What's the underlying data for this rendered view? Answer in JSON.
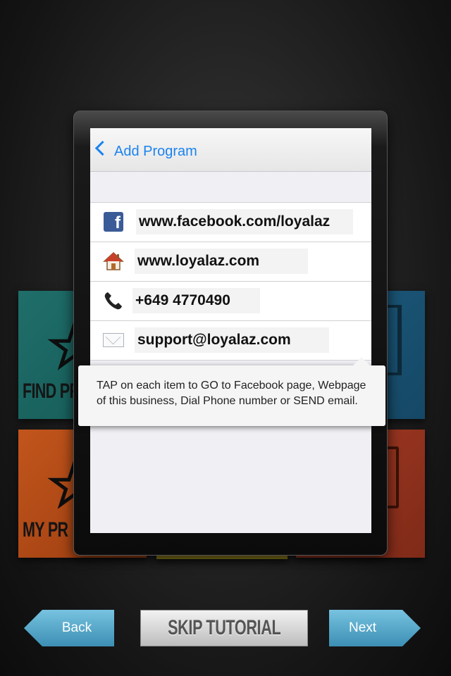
{
  "colors": {
    "accent_blue": "#1a83ee",
    "button_blue": "#5aaed0",
    "facebook_blue": "#3b5b98",
    "teal_tile": "#1f6e6a",
    "orange_tile": "#c2551c",
    "blue_tile": "#1c5a7c",
    "red_tile": "#a33a24"
  },
  "background_tiles": {
    "find": {
      "label": "FIND PR",
      "icon": "star-icon"
    },
    "my": {
      "label": "MY PR",
      "icon": "star-icon"
    },
    "right_top": {
      "icon": "qr-code-icon"
    },
    "right_bottom": {
      "icon": "phone-outline-icon"
    }
  },
  "screen": {
    "nav": {
      "back_label": "Add Program",
      "back_icon": "chevron-left-icon"
    },
    "contacts": [
      {
        "icon": "facebook-icon",
        "value": "www.facebook.com/loyalaz"
      },
      {
        "icon": "home-icon",
        "value": "www.loyalaz.com"
      },
      {
        "icon": "phone-icon",
        "value": "+649 4770490"
      },
      {
        "icon": "mail-icon",
        "value": "support@loyalaz.com"
      }
    ]
  },
  "tooltip": {
    "text": "TAP on each item to GO to Facebook page, Webpage of this business, Dial Phone number or SEND email."
  },
  "footer": {
    "back_label": "Back",
    "skip_label": "SKIP TUTORIAL",
    "next_label": "Next"
  }
}
